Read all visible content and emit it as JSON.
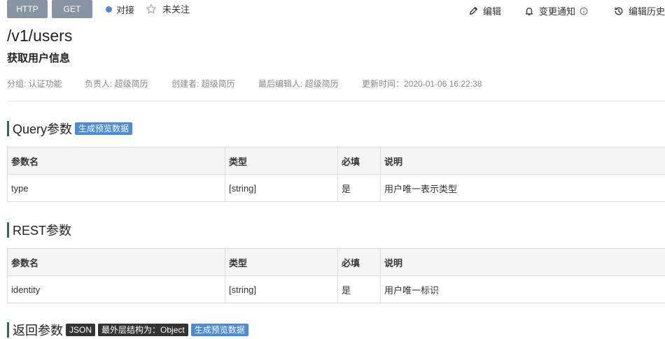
{
  "header": {
    "protocol_tag": "HTTP",
    "method_tag": "GET",
    "status_label": "对接",
    "follow_label": "未关注",
    "actions": {
      "edit": "编辑",
      "notify": "变更通知",
      "history": "编辑历史"
    }
  },
  "api": {
    "path": "/v1/users",
    "name": "获取用户信息"
  },
  "meta": {
    "group": "分组: 认证功能",
    "owner": "负责人: 超级简历",
    "creator": "创建者: 超级简历",
    "last_editor": "最后编辑人: 超级简历",
    "updated": "更新时间：2020-01-06 16:22:38"
  },
  "columns": [
    "参数名",
    "类型",
    "必填",
    "说明"
  ],
  "query_section": {
    "title": "Query参数",
    "badge": "生成预览数据",
    "rows": [
      {
        "name": "type",
        "type": "[string]",
        "required": "是",
        "desc": "用户唯一表示类型"
      }
    ]
  },
  "rest_section": {
    "title": "REST参数",
    "rows": [
      {
        "name": "identity",
        "type": "[string]",
        "required": "是",
        "desc": "用户唯一标识"
      }
    ]
  },
  "response_section": {
    "title": "返回参数",
    "badge_json": "JSON",
    "badge_structure": "最外层结构为：Object",
    "badge_preview": "生成预览数据"
  },
  "colors": {
    "tag_bg": "#8894a3",
    "status_dot": "#4a8be0",
    "section_bar": "#2e6b57",
    "badge_blue": "#4a8be0",
    "badge_dark": "#333333"
  }
}
